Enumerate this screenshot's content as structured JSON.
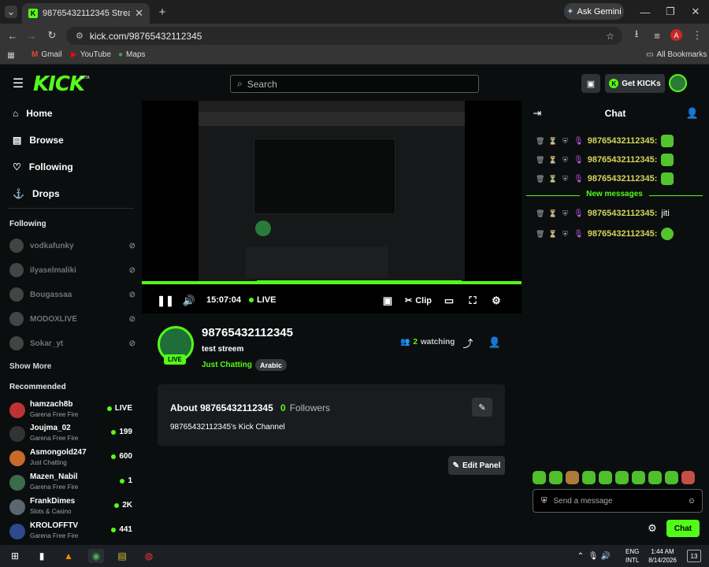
{
  "browser": {
    "tab_title": "98765432112345 Stream - …",
    "new_tab": "+",
    "ask_gemini": "Ask Gemini",
    "url": "kick.com/98765432112345",
    "bookmarks": [
      "Gmail",
      "YouTube",
      "Maps"
    ],
    "all_bookmarks": "All Bookmarks",
    "profile_initial": "A"
  },
  "header": {
    "logo": "KICK",
    "beta": "BETA",
    "search_placeholder": "Search",
    "get_kicks": "Get KICKs"
  },
  "sidebar": {
    "nav": [
      "Home",
      "Browse",
      "Following",
      "Drops"
    ],
    "following_title": "Following",
    "following": [
      "vodkafunky",
      "ilyaselmaliki",
      "Bougassaa",
      "MODOXLIVE",
      "Sokar_yt"
    ],
    "show_more": "Show More",
    "recommended_title": "Recommended",
    "recommended": [
      {
        "name": "hamzach8b",
        "category": "Garena Free Fire",
        "count": "LIVE"
      },
      {
        "name": "Joujma_02",
        "category": "Garena Free Fire",
        "count": "199"
      },
      {
        "name": "Asmongold247",
        "category": "Just Chatting",
        "count": "600"
      },
      {
        "name": "Mazen_Nabil",
        "category": "Garena Free Fire",
        "count": "1"
      },
      {
        "name": "FrankDimes",
        "category": "Slots & Casino",
        "count": "2K"
      },
      {
        "name": "KROLOFFTV",
        "category": "Garena Free Fire",
        "count": "441"
      }
    ]
  },
  "player": {
    "time": "15:07:04",
    "live": "LIVE",
    "clip": "Clip"
  },
  "channel": {
    "name": "98765432112345",
    "title": "test streem",
    "category": "Just Chatting",
    "tag": "Arabic",
    "live_badge": "LIVE",
    "watching_count": "2",
    "watching_label": "watching"
  },
  "about": {
    "title": "About 98765432112345",
    "followers_count": "0",
    "followers_label": "Followers",
    "description": "98765432112345's Kick Channel",
    "edit_panel": "Edit Panel"
  },
  "chat": {
    "title": "Chat",
    "messages": [
      {
        "user": "98765432112345:",
        "text": ""
      },
      {
        "user": "98765432112345:",
        "text": ""
      },
      {
        "user": "98765432112345:",
        "text": ""
      },
      {
        "user": "98765432112345:",
        "text": "jiti"
      },
      {
        "user": "98765432112345:",
        "text": ""
      }
    ],
    "new_messages": "New messages",
    "send_placeholder": "Send a message",
    "chat_button": "Chat"
  },
  "taskbar": {
    "lang": "ENG",
    "layout": "INTL",
    "time": "1:44 AM",
    "date": "8/14/2026",
    "notif": "13"
  },
  "colors": {
    "accent": "#53fc18",
    "bg": "#0b0e0f",
    "username": "#d6d65a"
  }
}
